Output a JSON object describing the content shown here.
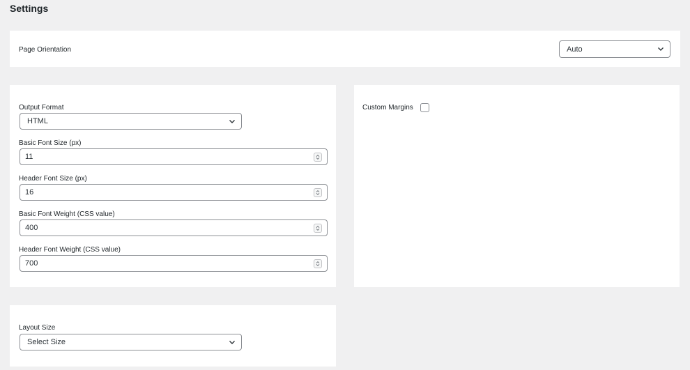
{
  "page": {
    "title": "Settings"
  },
  "orientation": {
    "label": "Page Orientation",
    "value": "Auto"
  },
  "fonts": {
    "output_format": {
      "label": "Output Format",
      "value": "HTML"
    },
    "basic_font_size": {
      "label": "Basic Font Size (px)",
      "value": "11"
    },
    "header_font_size": {
      "label": "Header Font Size (px)",
      "value": "16"
    },
    "basic_font_weight": {
      "label": "Basic Font Weight (CSS value)",
      "value": "400"
    },
    "header_font_weight": {
      "label": "Header Font Weight (CSS value)",
      "value": "700"
    }
  },
  "margins": {
    "label": "Custom Margins"
  },
  "layout": {
    "label": "Layout Size",
    "value": "Select Size"
  },
  "icons": {
    "dropdown": "chevron-down-icon",
    "spinner": "spinner-arrows-icon"
  }
}
